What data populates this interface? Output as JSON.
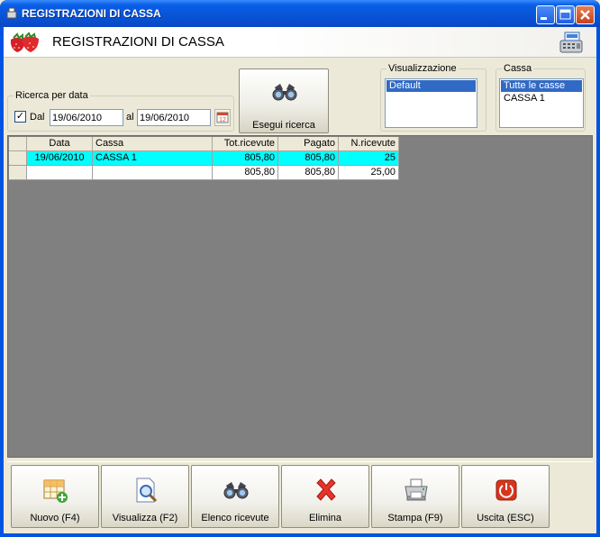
{
  "window": {
    "title": "REGISTRAZIONI DI CASSA"
  },
  "header": {
    "title": "REGISTRAZIONI DI CASSA"
  },
  "search": {
    "group_label": "Ricerca per data",
    "checkbox_checked": true,
    "checkbox_mark": "✓",
    "from_label": "Dal",
    "from_value": "19/06/2010",
    "to_label": "al",
    "to_value": "19/06/2010",
    "button_label": "Esegui ricerca"
  },
  "view": {
    "group_label": "Visualizzazione",
    "items": [
      "Default"
    ],
    "selected": 0
  },
  "cassa": {
    "group_label": "Cassa",
    "items": [
      "Tutte le casse",
      "CASSA 1"
    ],
    "selected": 0
  },
  "grid": {
    "columns": [
      "",
      "Data",
      "Cassa",
      "Tot.ricevute",
      "Pagato",
      "N.ricevute"
    ],
    "rows": [
      {
        "data": "19/06/2010",
        "cassa": "CASSA 1",
        "tot": "805,80",
        "pagato": "805,80",
        "n": "25"
      }
    ],
    "totals": {
      "data": "",
      "cassa": "",
      "tot": "805,80",
      "pagato": "805,80",
      "n": "25,00"
    }
  },
  "toolbar": {
    "new_label": "Nuovo (F4)",
    "view_label": "Visualizza (F2)",
    "list_label": "Elenco ricevute",
    "delete_label": "Elimina",
    "print_label": "Stampa (F9)",
    "exit_label": "Uscita (ESC)"
  },
  "colors": {
    "title_bar": "#0A5FE6",
    "selection": "#316AC5",
    "row_highlight": "#00FFFF",
    "grid_background": "#808080",
    "delete": "#E8332A",
    "exit": "#D8351C"
  }
}
